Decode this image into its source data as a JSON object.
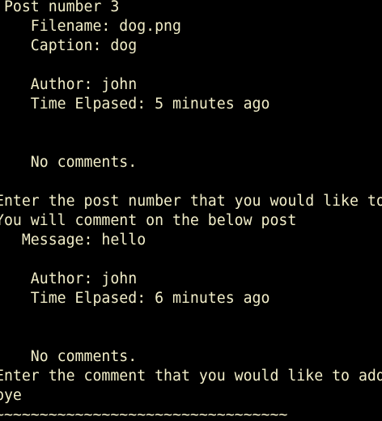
{
  "terminal": {
    "foreground_color": "#F2EEC9",
    "background_color": "#000000",
    "lines": [
      " Post number 3",
      "    Filename: dog.png",
      "    Caption: dog",
      "",
      "    Author: john",
      "    Time Elpased: 5 minutes ago",
      "",
      "",
      "    No comments.",
      "",
      "Enter the post number that you would like to",
      "You will comment on the below post",
      "   Message: hello",
      "",
      "    Author: john",
      "    Time Elpased: 6 minutes ago",
      "",
      "",
      "    No comments.",
      "Enter the comment that you would like to add",
      "bye",
      "~~~~~~~~~~~~~~~~~~~~~~~~~~~~~~~~~"
    ]
  }
}
